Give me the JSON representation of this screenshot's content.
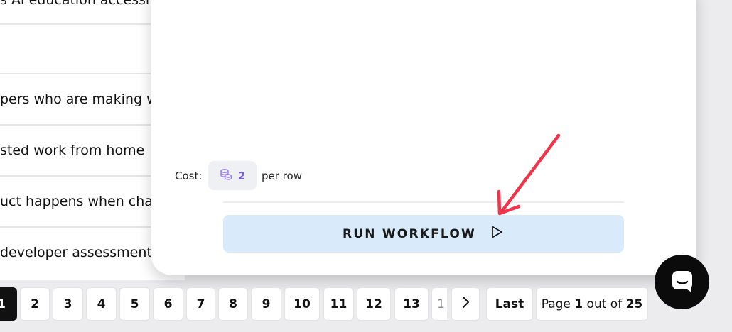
{
  "table": {
    "rows": [
      "s AI education accessi",
      "",
      "pers who are making w",
      "sted work from home ",
      "uct happens when cha",
      "developer assessment"
    ]
  },
  "modal": {
    "cost_label": "Cost:",
    "cost_value": "2",
    "cost_unit": "per row",
    "run_button_label": "RUN WORKFLOW"
  },
  "pagination": {
    "pages": [
      "1",
      "2",
      "3",
      "4",
      "5",
      "6",
      "7",
      "8",
      "9",
      "10",
      "11",
      "12",
      "13",
      "1"
    ],
    "last_label": "Last",
    "info_prefix": "Page",
    "current_page": "1",
    "info_mid": "out of",
    "total_pages": "25"
  },
  "colors": {
    "accent_button": "#d9ebfb",
    "credit_icon": "#7b5cd6",
    "annotation_arrow": "#f0344a"
  },
  "icons": {
    "credits": "coins-stack-icon",
    "run": "play-outline-icon",
    "next": "chevron-right-icon",
    "chat": "chat-bubble-icon",
    "annotation": "red-arrow-annotation"
  }
}
